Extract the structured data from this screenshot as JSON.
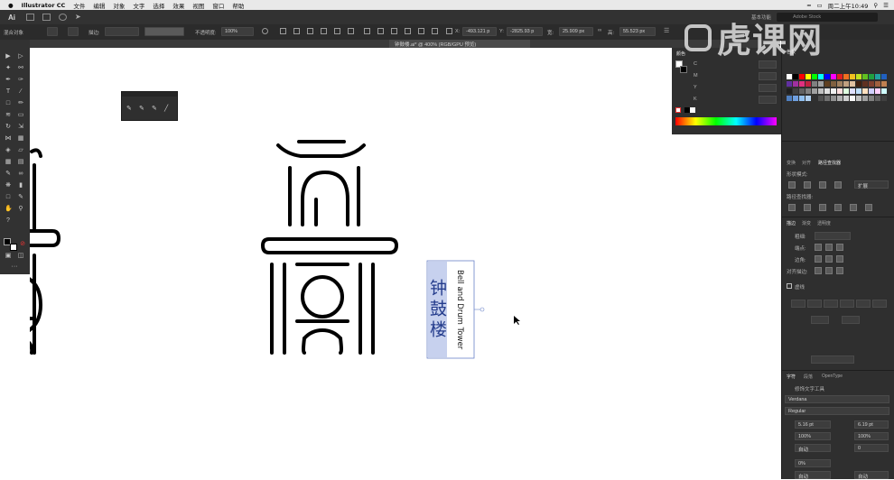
{
  "menubar": {
    "app_name": "Illustrator CC",
    "items": [
      "文件",
      "编辑",
      "对象",
      "文字",
      "选择",
      "效果",
      "视图",
      "窗口",
      "帮助"
    ],
    "clock": "周二上午10:49"
  },
  "appbar": {
    "logo": "Ai",
    "workspace_label": "基本功能",
    "search_placeholder": "Adobe Stock"
  },
  "control_bar": {
    "selection_label": "混合对象",
    "stroke_label": "描边:",
    "opacity_label": "不透明度:",
    "opacity_value": "100%",
    "x_label": "X:",
    "x_value": "-493.121 p",
    "y_label": "Y:",
    "y_value": "-2825.93 p",
    "w_label": "宽:",
    "w_value": "25.909 px",
    "h_label": "高:",
    "h_value": "55.523 px"
  },
  "document_tab": {
    "title": "钟鼓楼.ai* @ 400% (RGB/GPU 预览)"
  },
  "canvas": {
    "vertical_label": "Bell and Drum Tower",
    "vertical_title": "钟鼓楼"
  },
  "color_panel": {
    "tabs": [
      "颜色",
      "色板"
    ],
    "channels": [
      "C",
      "M",
      "Y",
      "K"
    ],
    "colors": {
      "spectrum_start": "#ff0000",
      "spectrum_end": "#ff00ff"
    }
  },
  "right_panel": {
    "tabs_transform": [
      "变换",
      "对齐",
      "路径查找器"
    ],
    "shape_modes_label": "形状模式:",
    "expand_label": "扩展",
    "pathfinder_label": "路径查找器:",
    "tabs_stroke": [
      "描边",
      "渐变",
      "透明度"
    ],
    "weight_label": "粗细:",
    "cap_label": "端点:",
    "corner_label": "边角:",
    "align_stroke_label": "对齐描边:",
    "dashed_label": "虚线",
    "tabs_character": [
      "字符",
      "段落",
      "OpenType"
    ],
    "touch_tool_label": "修饰文字工具",
    "font_family": "Verdana",
    "font_style": "Regular",
    "font_size": "5.16 pt",
    "leading": "6.19 pt",
    "scale_v": "100%",
    "scale_h": "100%",
    "kerning": "自动",
    "tracking": "0",
    "baseline": "0%",
    "rotation": "自动",
    "language_label": "自动"
  },
  "watermark": {
    "text": "虎课网"
  }
}
